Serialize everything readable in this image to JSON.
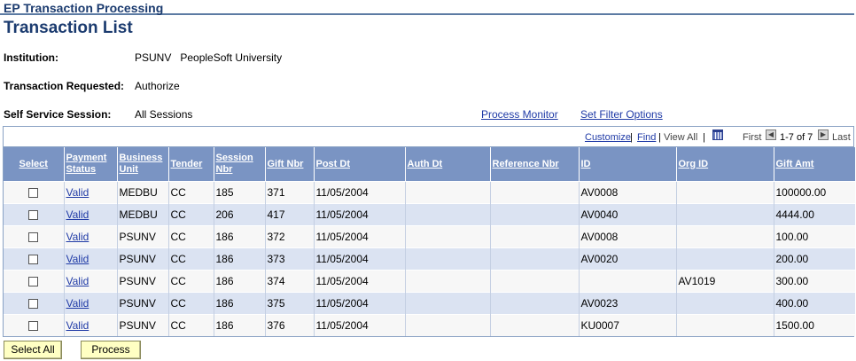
{
  "header": {
    "app_title": "EP Transaction Processing",
    "page_title": "Transaction List"
  },
  "fields": {
    "institution_label": "Institution:",
    "institution_code": "PSUNV",
    "institution_name": "PeopleSoft University",
    "transaction_label": "Transaction Requested:",
    "transaction_value": "Authorize",
    "session_label": "Self Service Session:",
    "session_value": "All Sessions"
  },
  "links": {
    "process_monitor": "Process Monitor",
    "set_filter_options": "Set Filter Options"
  },
  "grid_nav": {
    "customize": "Customize",
    "sep": "|",
    "find": "Find",
    "view_all": "View All",
    "first": "First",
    "range": "1-7 of 7",
    "last": "Last"
  },
  "columns": {
    "select": "Select",
    "payment_status": "Payment Status",
    "business_unit": "Business Unit",
    "tender": "Tender",
    "session_nbr": "Session Nbr",
    "gift_nbr": "Gift Nbr",
    "post_dt": "Post Dt",
    "auth_dt": "Auth Dt",
    "reference_nbr": "Reference Nbr",
    "id": "ID",
    "org_id": "Org ID",
    "gift_amt": "Gift Amt"
  },
  "rows": [
    {
      "status": "Valid",
      "bu": "MEDBU",
      "tender": "CC",
      "session": "185",
      "gift": "371",
      "post": "11/05/2004",
      "auth": "",
      "ref": "",
      "id": "AV0008",
      "org": "",
      "amt": "100000.00"
    },
    {
      "status": "Valid",
      "bu": "MEDBU",
      "tender": "CC",
      "session": "206",
      "gift": "417",
      "post": "11/05/2004",
      "auth": "",
      "ref": "",
      "id": "AV0040",
      "org": "",
      "amt": "4444.00"
    },
    {
      "status": "Valid",
      "bu": "PSUNV",
      "tender": "CC",
      "session": "186",
      "gift": "372",
      "post": "11/05/2004",
      "auth": "",
      "ref": "",
      "id": "AV0008",
      "org": "",
      "amt": "100.00"
    },
    {
      "status": "Valid",
      "bu": "PSUNV",
      "tender": "CC",
      "session": "186",
      "gift": "373",
      "post": "11/05/2004",
      "auth": "",
      "ref": "",
      "id": "AV0020",
      "org": "",
      "amt": "200.00"
    },
    {
      "status": "Valid",
      "bu": "PSUNV",
      "tender": "CC",
      "session": "186",
      "gift": "374",
      "post": "11/05/2004",
      "auth": "",
      "ref": "",
      "id": "",
      "org": "AV1019",
      "amt": "300.00"
    },
    {
      "status": "Valid",
      "bu": "PSUNV",
      "tender": "CC",
      "session": "186",
      "gift": "375",
      "post": "11/05/2004",
      "auth": "",
      "ref": "",
      "id": "AV0023",
      "org": "",
      "amt": "400.00"
    },
    {
      "status": "Valid",
      "bu": "PSUNV",
      "tender": "CC",
      "session": "186",
      "gift": "376",
      "post": "11/05/2004",
      "auth": "",
      "ref": "",
      "id": "KU0007",
      "org": "",
      "amt": "1500.00"
    }
  ],
  "buttons": {
    "select_all": "Select All",
    "process": "Process"
  },
  "colors": {
    "header_blue": "#7a94c3",
    "title_blue": "#1b3b6f",
    "row_alt": "#dbe3f2",
    "button_yellow": "#ffffc3",
    "link_blue": "#1f3aa6"
  }
}
